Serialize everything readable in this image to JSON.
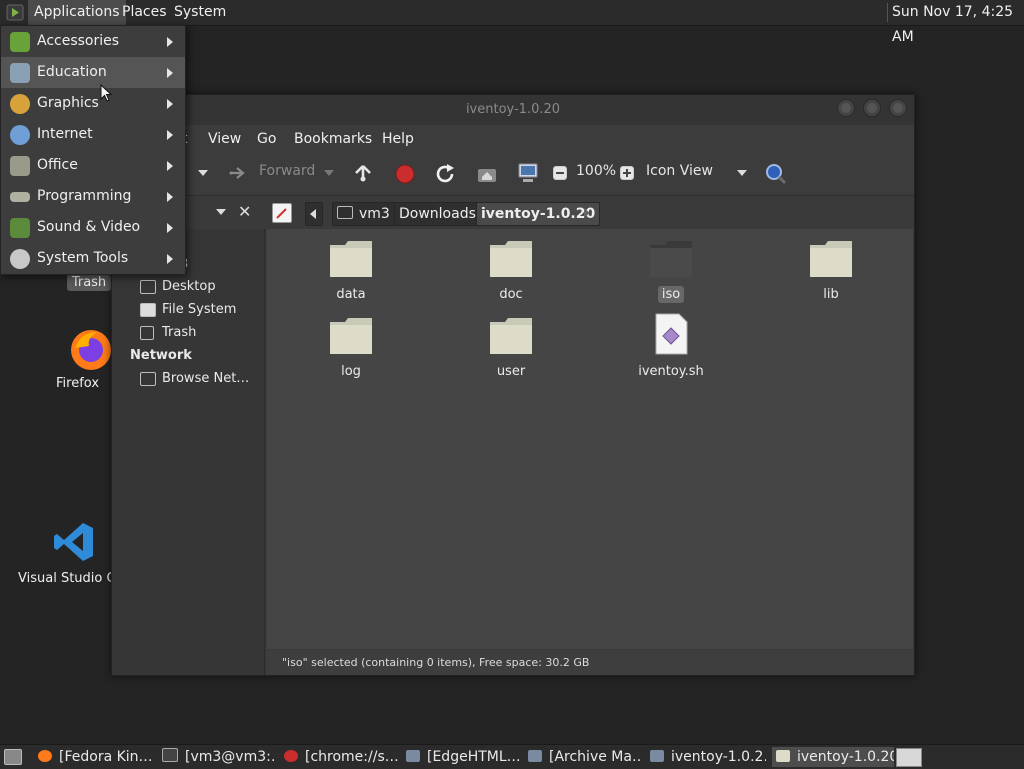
{
  "top_panel": {
    "menus": [
      "Applications",
      "Places",
      "System"
    ],
    "clock": "Sun Nov 17,  4:25 AM"
  },
  "applications_menu": [
    {
      "label": "Accessories",
      "icon": "accessories-icon"
    },
    {
      "label": "Education",
      "icon": "education-icon"
    },
    {
      "label": "Graphics",
      "icon": "graphics-icon"
    },
    {
      "label": "Internet",
      "icon": "internet-icon"
    },
    {
      "label": "Office",
      "icon": "office-icon"
    },
    {
      "label": "Programming",
      "icon": "programming-icon"
    },
    {
      "label": "Sound & Video",
      "icon": "sound-video-icon"
    },
    {
      "label": "System Tools",
      "icon": "system-tools-icon"
    }
  ],
  "desktop": {
    "icons": [
      {
        "label": "Trash"
      },
      {
        "label": "Firefox"
      },
      {
        "label": "Visual Studio Co"
      }
    ]
  },
  "file_manager": {
    "title": "iventoy-1.0.20",
    "menu": [
      "t",
      "View",
      "Go",
      "Bookmarks",
      "Help"
    ],
    "toolbar": {
      "forward": "Forward",
      "zoom": "100%",
      "view_mode": "Icon View"
    },
    "breadcrumbs": [
      "vm3",
      "Downloads",
      "iventoy-1.0.20"
    ],
    "sidebar": {
      "partial_items": [
        "er",
        "3"
      ],
      "places": [
        "Desktop",
        "File System",
        "Trash"
      ],
      "network_heading": "Network",
      "network": [
        "Browse Net…"
      ]
    },
    "files": [
      {
        "name": "data",
        "type": "folder"
      },
      {
        "name": "doc",
        "type": "folder"
      },
      {
        "name": "iso",
        "type": "folder",
        "selected": true
      },
      {
        "name": "lib",
        "type": "folder"
      },
      {
        "name": "log",
        "type": "folder"
      },
      {
        "name": "user",
        "type": "folder"
      },
      {
        "name": "iventoy.sh",
        "type": "script"
      }
    ],
    "status": "\"iso\" selected (containing 0 items), Free space: 30.2 GB"
  },
  "taskbar": [
    {
      "label": "[Fedora Kin…",
      "icon": "firefox-icon"
    },
    {
      "label": "[vm3@vm3:…",
      "icon": "terminal-icon"
    },
    {
      "label": "[chrome://s…",
      "icon": "opera-icon"
    },
    {
      "label": "[EdgeHTML…",
      "icon": "window-icon"
    },
    {
      "label": "[Archive Ma…",
      "icon": "window-icon"
    },
    {
      "label": "iventoy-1.0.2…",
      "icon": "window-icon"
    },
    {
      "label": "iventoy-1.0.20",
      "icon": "folder-icon"
    }
  ],
  "colors": {
    "panel": "#2b2b2b",
    "desktop": "#242424",
    "folder": "#dcdcc8",
    "selected_folder": "#4a4a4a",
    "record_red": "#d03030",
    "search_blue": "#3a6fd0",
    "vscode_blue": "#2f8ad8",
    "firefox_orange": "#ff7a18"
  }
}
